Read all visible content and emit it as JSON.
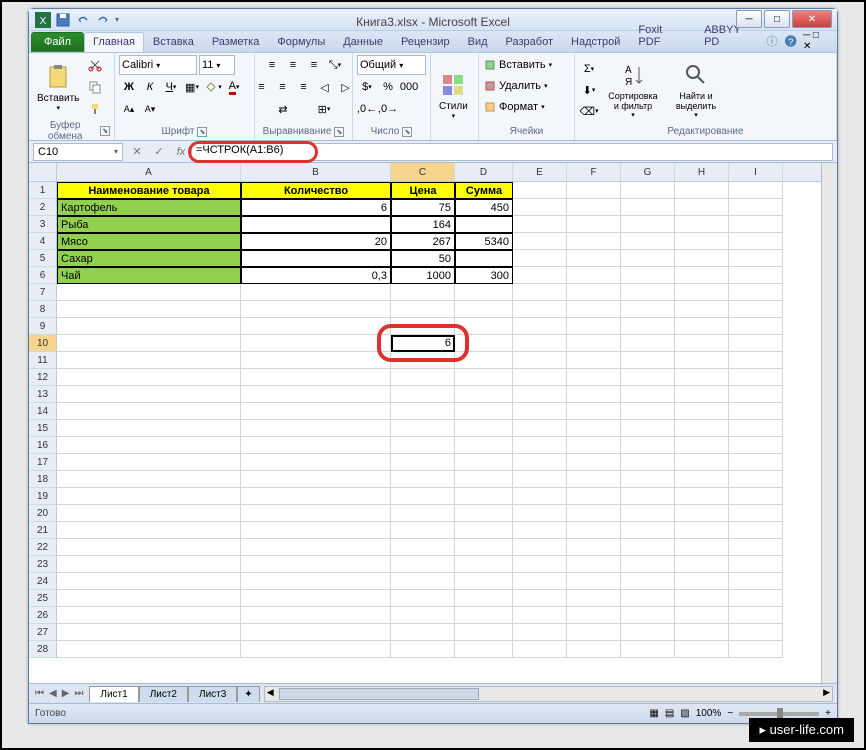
{
  "window": {
    "title": "Книга3.xlsx - Microsoft Excel",
    "min": "─",
    "max": "□",
    "close": "✕"
  },
  "tabs": {
    "file": "Файл",
    "items": [
      "Главная",
      "Вставка",
      "Разметка",
      "Формулы",
      "Данные",
      "Рецензир",
      "Вид",
      "Разработ",
      "Надстрой",
      "Foxit PDF",
      "ABBYY PD"
    ],
    "active": 0
  },
  "ribbon": {
    "clipboard": {
      "paste": "Вставить",
      "label": "Буфер обмена"
    },
    "font": {
      "name": "Calibri",
      "size": "11",
      "label": "Шрифт"
    },
    "alignment": {
      "label": "Выравнивание"
    },
    "number": {
      "format": "Общий",
      "label": "Число"
    },
    "styles": {
      "btn": "Стили",
      "label": ""
    },
    "cells": {
      "insert": "Вставить",
      "delete": "Удалить",
      "format": "Формат",
      "label": "Ячейки"
    },
    "editing": {
      "sort": "Сортировка и фильтр",
      "find": "Найти и выделить",
      "label": "Редактирование"
    }
  },
  "formula_bar": {
    "name_box": "C10",
    "fx": "fx",
    "formula": "=ЧСТРОК(A1:B6)"
  },
  "columns": [
    "A",
    "B",
    "C",
    "D",
    "E",
    "F",
    "G",
    "H",
    "I"
  ],
  "col_widths": [
    "colA",
    "colB",
    "colC",
    "colD",
    "colE",
    "colF",
    "colG",
    "colH",
    "colI"
  ],
  "rows": [
    1,
    2,
    3,
    4,
    5,
    6,
    7,
    8,
    9,
    10,
    11,
    12,
    13,
    14,
    15,
    16,
    17,
    18,
    19,
    20,
    21,
    22,
    23,
    24,
    25,
    26,
    27,
    28
  ],
  "headers": {
    "a": "Наименование товара",
    "b": "Количество",
    "c": "Цена",
    "d": "Сумма"
  },
  "data": [
    {
      "name": "Картофель",
      "qty": "6",
      "price": "75",
      "sum": "450"
    },
    {
      "name": "Рыба",
      "qty": "",
      "price": "164",
      "sum": ""
    },
    {
      "name": "Мясо",
      "qty": "20",
      "price": "267",
      "sum": "5340"
    },
    {
      "name": "Сахар",
      "qty": "",
      "price": "50",
      "sum": ""
    },
    {
      "name": "Чай",
      "qty": "0,3",
      "price": "1000",
      "sum": "300"
    }
  ],
  "result_cell": {
    "value": "6"
  },
  "selected": {
    "row": 10,
    "col": "C"
  },
  "sheets": {
    "active": "Лист1",
    "others": [
      "Лист2",
      "Лист3"
    ]
  },
  "status": {
    "ready": "Готово",
    "zoom": "100%"
  },
  "watermark": "user-life.com"
}
